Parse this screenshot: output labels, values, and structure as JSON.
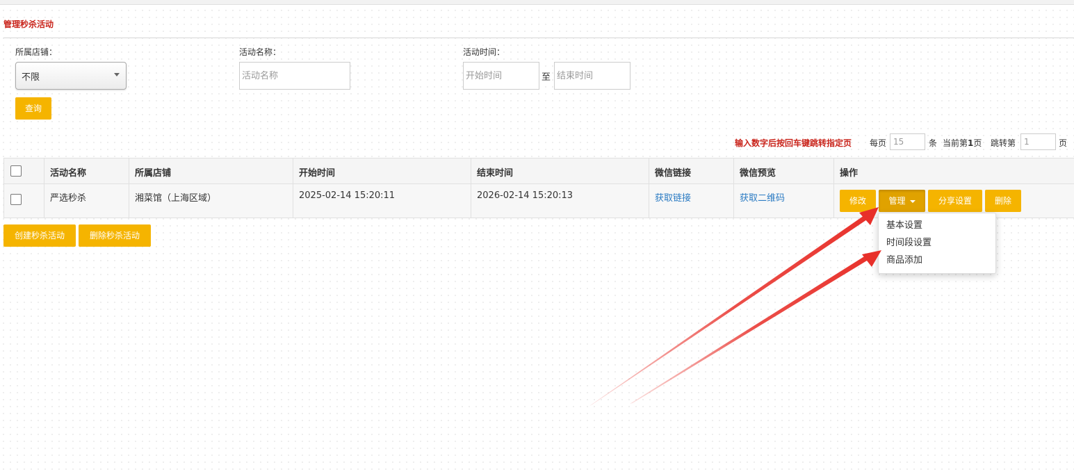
{
  "header": {
    "title": "管理秒杀活动"
  },
  "filters": {
    "store_label": "所属店铺：",
    "store_value": "不限",
    "name_label": "活动名称：",
    "name_placeholder": "活动名称",
    "time_label": "活动时间：",
    "start_placeholder": "开始时间",
    "to_label": "至",
    "end_placeholder": "结束时间",
    "query_button": "查询"
  },
  "pagination": {
    "hint": "输入数字后按回车键跳转指定页",
    "per_page_label": "每页",
    "per_page_value": "15",
    "unit_label": "条",
    "current_label_prefix": "当前第",
    "current_page": "1",
    "current_label_suffix": "页",
    "jump_label": "跳转第",
    "jump_value": "1",
    "page_suffix": "页"
  },
  "table": {
    "columns": [
      "活动名称",
      "所属店铺",
      "开始时间",
      "结束时间",
      "微信链接",
      "微信预览",
      "操作"
    ],
    "rows": [
      {
        "name": "严选秒杀",
        "store": "湘菜馆（上海区域）",
        "start": "2025-02-14 15:20:11",
        "end": "2026-02-14 15:20:13",
        "wechat_link": "获取链接",
        "wechat_preview": "获取二维码",
        "actions": {
          "edit": "修改",
          "manage": "管理",
          "share": "分享设置",
          "delete": "删除"
        }
      }
    ]
  },
  "dropdown": {
    "items": [
      "基本设置",
      "时间段设置",
      "商品添加"
    ]
  },
  "bottom_actions": {
    "create": "创建秒杀活动",
    "delete": "删除秒杀活动"
  },
  "colors": {
    "accent": "#f5b400",
    "title_red": "#c9241b",
    "link_blue": "#2b7bc3",
    "annotation_arrow": "#e8302a"
  }
}
